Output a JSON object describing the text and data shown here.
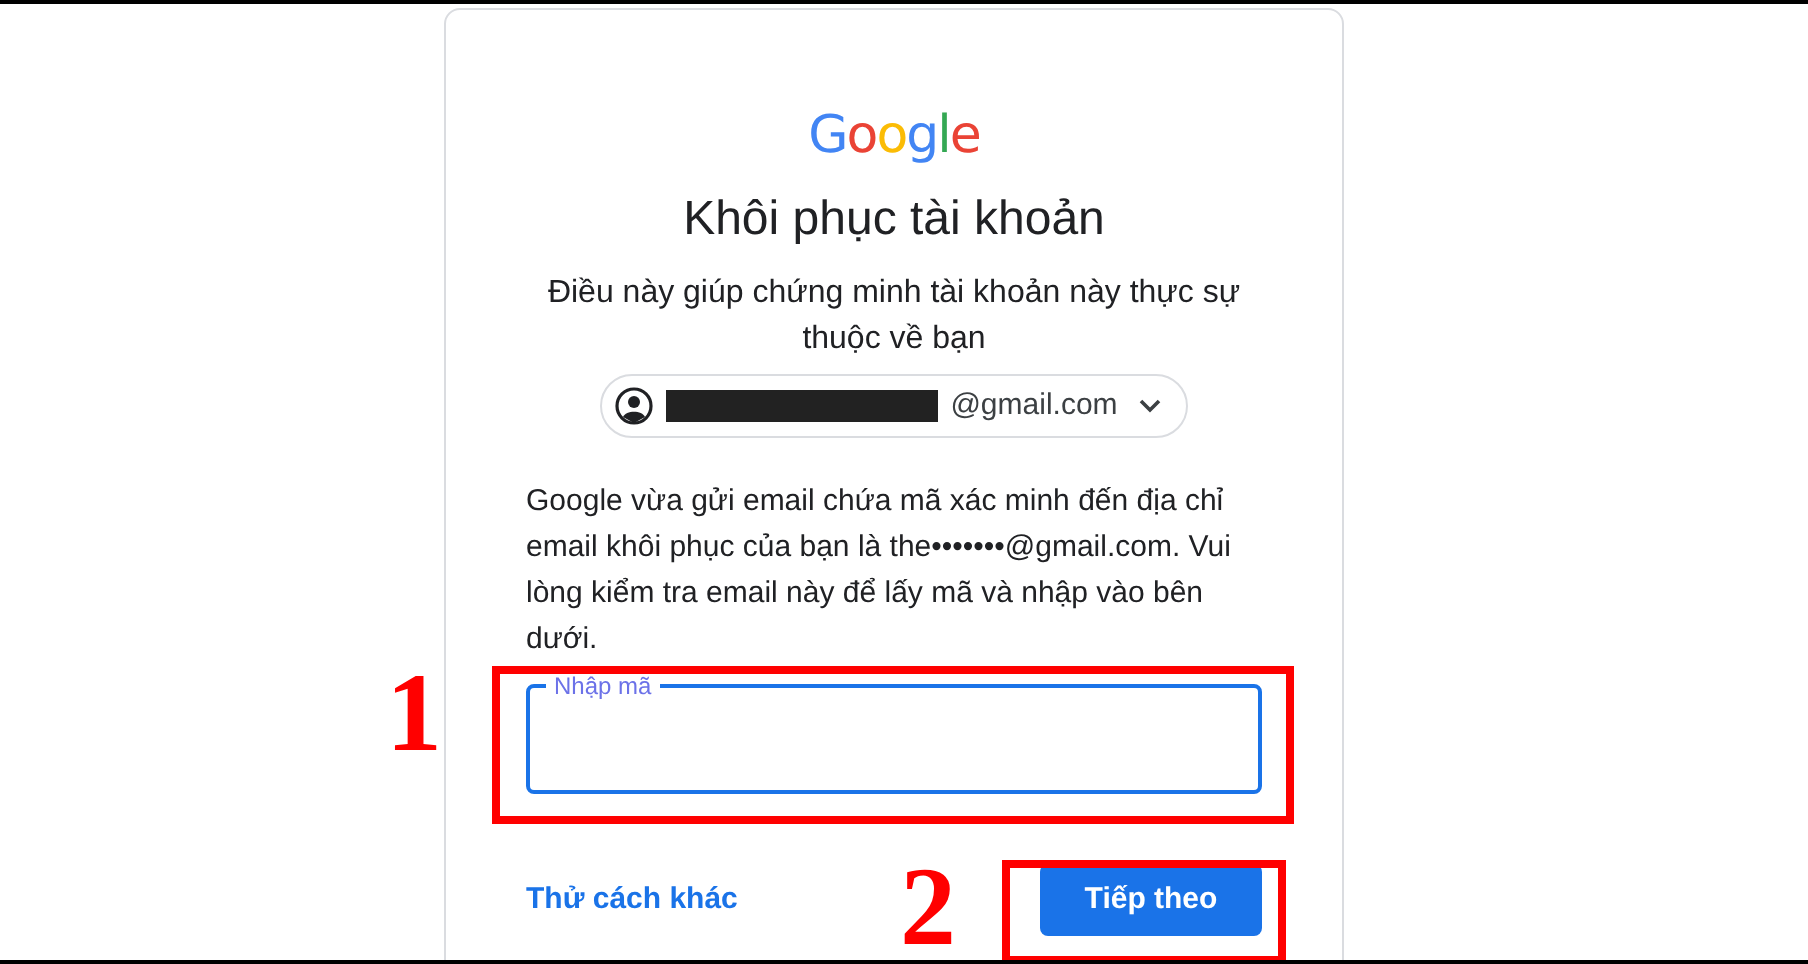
{
  "logo": "Google",
  "title": "Khôi phục tài khoản",
  "subtitle": "Điều này giúp chứng minh tài khoản này thực sự thuộc về bạn",
  "account": {
    "email": "@gmail.com",
    "redacted": true
  },
  "message": "Google vừa gửi email chứa mã xác minh đến địa chỉ email khôi phục của bạn là the•••••••@gmail.com. Vui lòng kiểm tra email này để lấy mã và nhập vào bên dưới.",
  "code_field": {
    "label": "Nhập mã",
    "focused": true
  },
  "try_another_link": "Thử cách khác",
  "next_button": "Tiếp theo",
  "annotations": [
    {
      "label": "1"
    },
    {
      "label": "2"
    }
  ]
}
